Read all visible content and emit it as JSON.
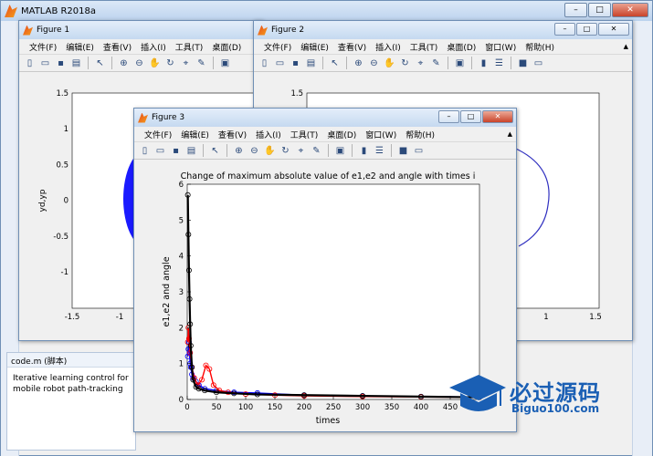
{
  "main_window": {
    "title": "MATLAB R2018a",
    "minimize": "–",
    "maximize": "□",
    "close": "✕"
  },
  "code_panel": {
    "header": "code.m (脚本)",
    "text_line1": "Iterative learning control for",
    "text_line2": "mobile robot path-tracking"
  },
  "menus": [
    "文件(F)",
    "编辑(E)",
    "查看(V)",
    "插入(I)",
    "工具(T)",
    "桌面(D)",
    "窗口(W)",
    "帮助(H)"
  ],
  "figure1": {
    "title": "Figure 1",
    "ylabel": "yd,yp",
    "yticks": [
      "1.5",
      "1",
      "0.5",
      "0",
      "-0.5",
      "-1"
    ],
    "xticks": [
      "-1.5",
      "-1"
    ]
  },
  "figure2": {
    "title": "Figure 2",
    "yticks": [
      "1.5"
    ],
    "xticks": [
      "1",
      "1.5"
    ]
  },
  "figure3": {
    "title": "Figure 3",
    "minimize": "–",
    "maximize": "□",
    "close": "✕"
  },
  "logo": {
    "cn": "必过源码",
    "en": "Biguo100.com"
  },
  "colors": {
    "series_e1": "#0000ff",
    "series_e2": "#ff0000",
    "series_angle": "#000000"
  },
  "chart_data": {
    "type": "line",
    "title": "Change of maximum absolute value of e1,e2 and angle with times i",
    "xlabel": "times",
    "ylabel": "e1,e2 and angle",
    "xlim": [
      0,
      500
    ],
    "ylim": [
      0,
      6
    ],
    "xticks": [
      0,
      50,
      100,
      150,
      200,
      250,
      300,
      350,
      400,
      450
    ],
    "yticks": [
      0,
      1,
      2,
      3,
      4,
      5,
      6
    ],
    "grid": false,
    "series": [
      {
        "x": [
          1,
          2,
          3,
          4,
          5,
          6,
          8,
          10,
          15,
          20,
          30,
          50,
          80,
          120,
          200,
          300,
          400,
          500
        ],
        "y": [
          1.2,
          1.4,
          1.6,
          1.3,
          1.0,
          0.9,
          0.7,
          0.6,
          0.5,
          0.4,
          0.3,
          0.25,
          0.2,
          0.18,
          0.12,
          0.1,
          0.08,
          0.07
        ]
      },
      {
        "x": [
          1,
          2,
          3,
          5,
          8,
          12,
          18,
          25,
          32,
          38,
          45,
          55,
          70,
          100,
          150,
          200,
          300,
          400,
          500
        ],
        "y": [
          1.6,
          2.0,
          1.7,
          1.3,
          0.9,
          0.6,
          0.4,
          0.55,
          0.95,
          0.85,
          0.4,
          0.25,
          0.2,
          0.15,
          0.12,
          0.1,
          0.08,
          0.07,
          0.06
        ]
      },
      {
        "x": [
          1,
          2,
          3,
          4,
          5,
          6,
          8,
          10,
          15,
          20,
          30,
          50,
          80,
          120,
          200,
          300,
          400,
          500
        ],
        "y": [
          5.7,
          4.6,
          3.6,
          2.8,
          2.1,
          1.5,
          0.9,
          0.55,
          0.35,
          0.3,
          0.25,
          0.2,
          0.17,
          0.14,
          0.12,
          0.1,
          0.08,
          0.06
        ]
      }
    ]
  }
}
